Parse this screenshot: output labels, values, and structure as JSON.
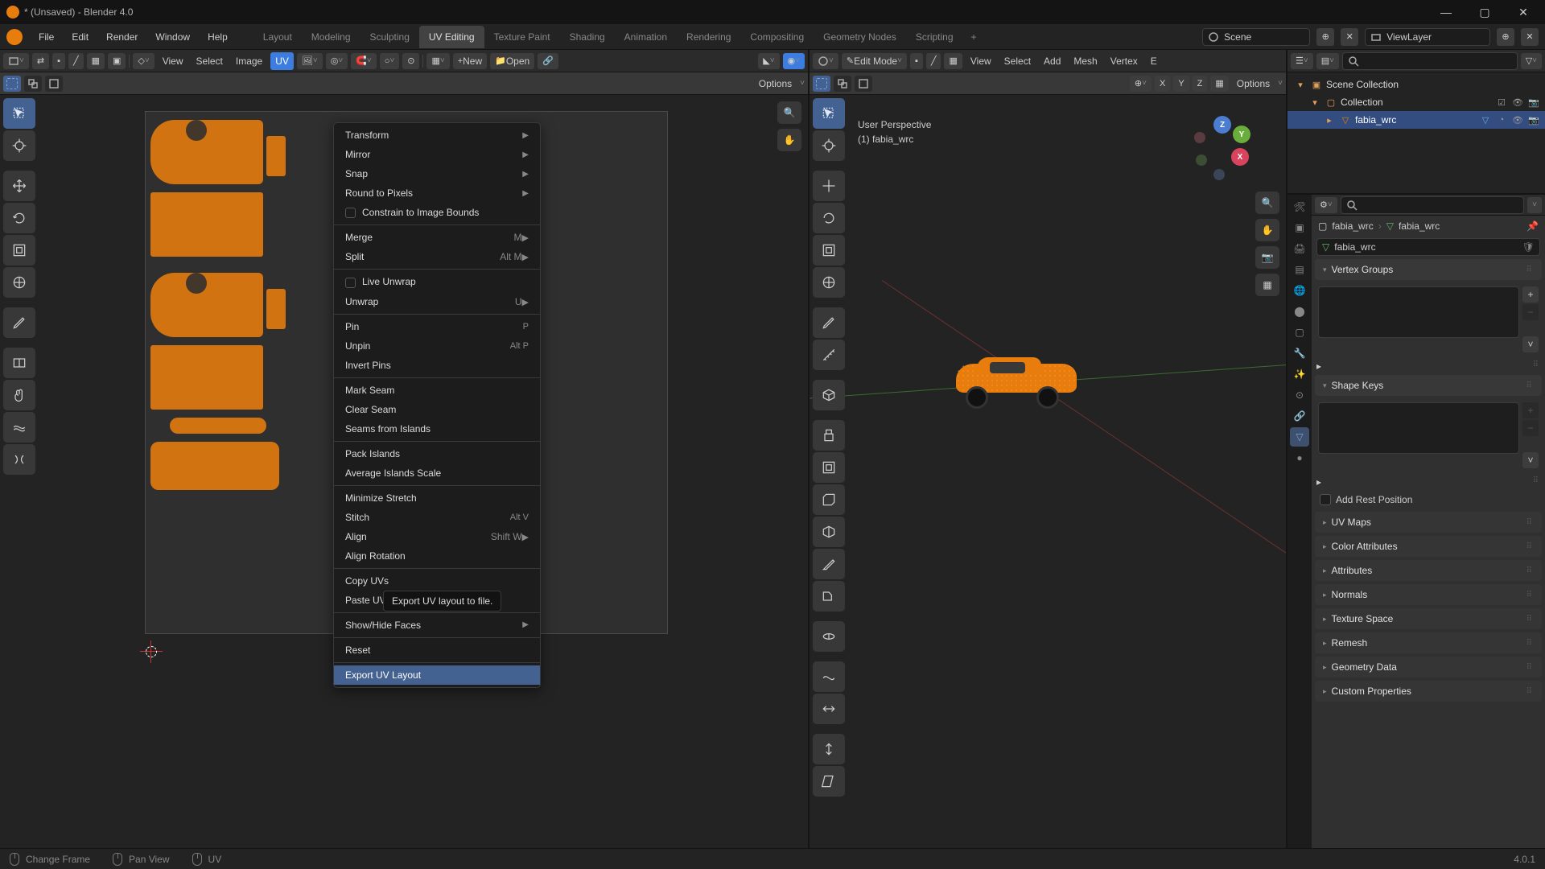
{
  "title": "* (Unsaved) - Blender 4.0",
  "topmenu": [
    "File",
    "Edit",
    "Render",
    "Window",
    "Help"
  ],
  "workspaces": [
    "Layout",
    "Modeling",
    "Sculpting",
    "UV Editing",
    "Texture Paint",
    "Shading",
    "Animation",
    "Rendering",
    "Compositing",
    "Geometry Nodes",
    "Scripting"
  ],
  "active_workspace": "UV Editing",
  "scene_name": "Scene",
  "viewlayer_name": "ViewLayer",
  "uv_header_menus": [
    "View",
    "Select",
    "Image",
    "UV"
  ],
  "uv_header_new": "New",
  "uv_header_open": "Open",
  "uv_options": "Options",
  "vp_mode": "Edit Mode",
  "vp_menus": [
    "View",
    "Select",
    "Add",
    "Mesh",
    "Vertex",
    "E"
  ],
  "vp_info_line1": "User Perspective",
  "vp_info_line2": "(1) fabia_wrc",
  "vp_axis": {
    "x": "X",
    "y": "Y",
    "z": "Z"
  },
  "uv_menu": {
    "transform": "Transform",
    "mirror": "Mirror",
    "snap": "Snap",
    "round_to_pixels": "Round to Pixels",
    "constrain": "Constrain to Image Bounds",
    "merge": "Merge",
    "merge_key": "M",
    "split": "Split",
    "split_key": "Alt M",
    "live_unwrap": "Live Unwrap",
    "unwrap": "Unwrap",
    "unwrap_key": "U",
    "pin": "Pin",
    "pin_key": "P",
    "unpin": "Unpin",
    "unpin_key": "Alt P",
    "invert_pins": "Invert Pins",
    "mark_seam": "Mark Seam",
    "clear_seam": "Clear Seam",
    "seams_from_islands": "Seams from Islands",
    "pack_islands": "Pack Islands",
    "average_islands": "Average Islands Scale",
    "minimize_stretch": "Minimize Stretch",
    "stitch": "Stitch",
    "stitch_key": "Alt V",
    "align": "Align",
    "align_key": "Shift W",
    "align_rotation": "Align Rotation",
    "copy_uvs": "Copy UVs",
    "paste_uvs": "Paste UVs",
    "show_hide_faces": "Show/Hide Faces",
    "reset": "Reset",
    "export_uv_layout": "Export UV Layout",
    "tooltip": "Export UV layout to file."
  },
  "outliner": {
    "scene_collection": "Scene Collection",
    "collection": "Collection",
    "object": "fabia_wrc"
  },
  "props": {
    "breadcrumb1": "fabia_wrc",
    "breadcrumb2": "fabia_wrc",
    "mesh_name": "fabia_wrc",
    "vertex_groups": "Vertex Groups",
    "shape_keys": "Shape Keys",
    "add_rest": "Add Rest Position",
    "uv_maps": "UV Maps",
    "color_attrs": "Color Attributes",
    "attributes": "Attributes",
    "normals": "Normals",
    "texture_space": "Texture Space",
    "remesh": "Remesh",
    "geometry_data": "Geometry Data",
    "custom_props": "Custom Properties"
  },
  "status": {
    "change_frame": "Change Frame",
    "pan_view": "Pan View",
    "uv": "UV",
    "version": "4.0.1"
  }
}
